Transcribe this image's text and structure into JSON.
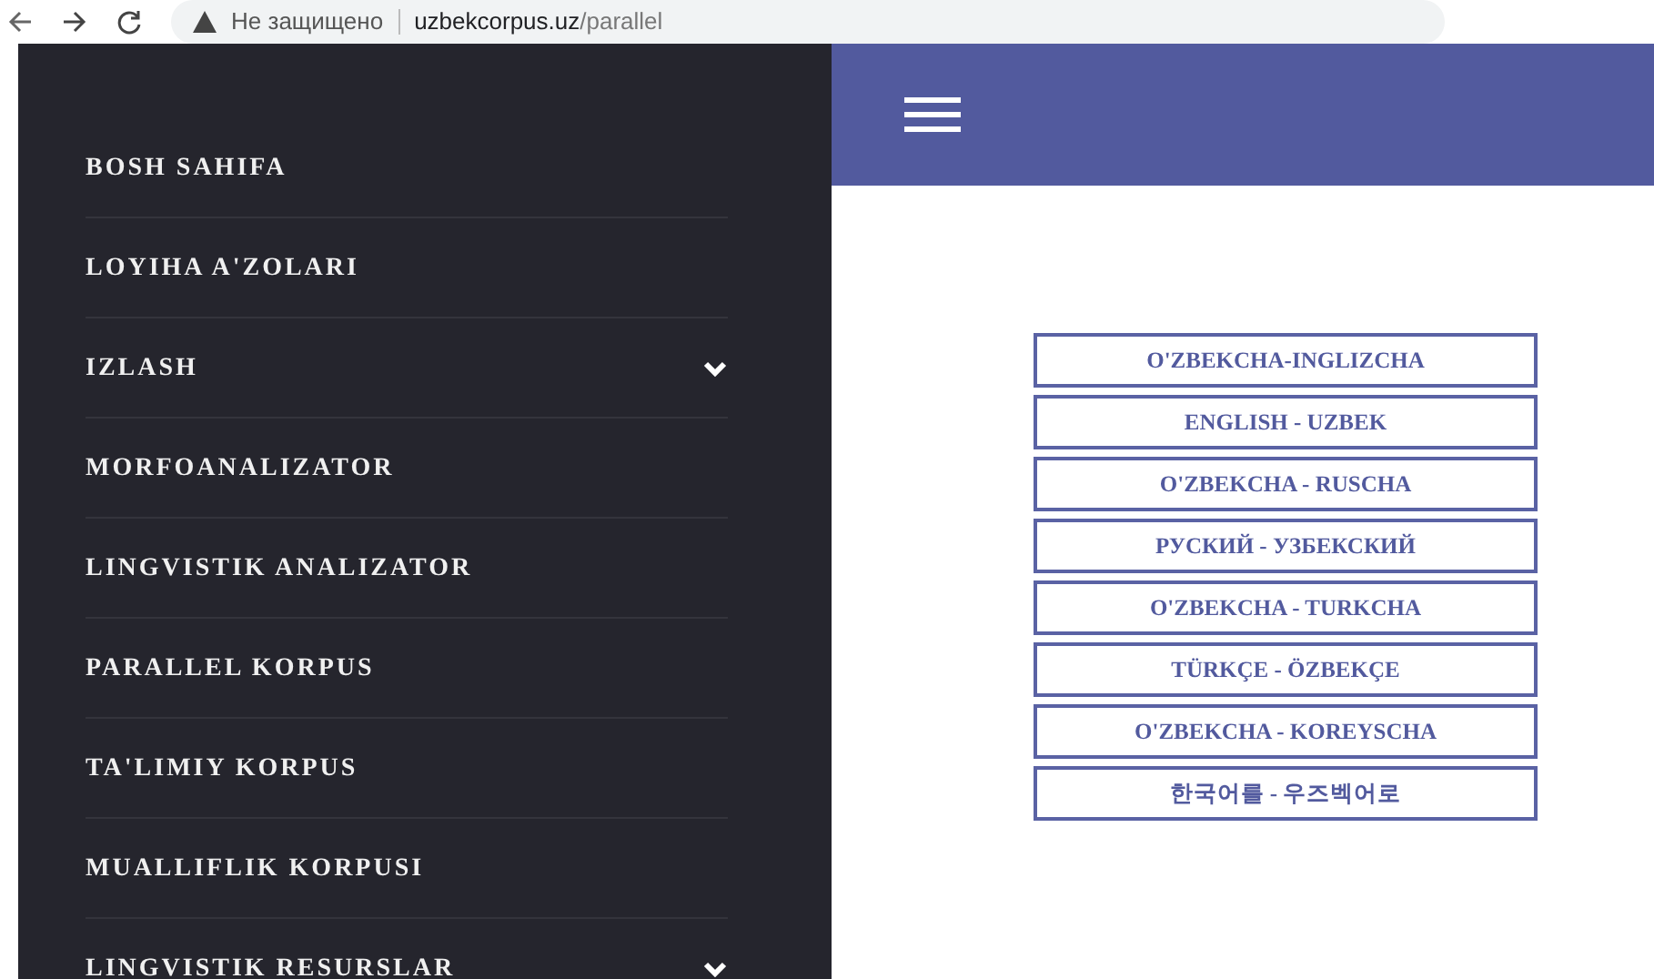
{
  "browser": {
    "security": "Не защищено",
    "url_host": "uzbekcorpus.uz",
    "url_path": "/parallel"
  },
  "sidebar": {
    "items": [
      {
        "label": "BOSH SAHIFA",
        "kind": "link"
      },
      {
        "label": "LOYIHA A'ZOLARI",
        "kind": "link"
      },
      {
        "label": "IZLASH",
        "kind": "dropdown"
      },
      {
        "label": "MORFOANALIZATOR",
        "kind": "link"
      },
      {
        "label": "LINGVISTIK ANALIZATOR",
        "kind": "link"
      },
      {
        "label": "PARALLEL KORPUS",
        "kind": "link"
      },
      {
        "label": "TA'LIMIY KORPUS",
        "kind": "link"
      },
      {
        "label": "MUALLIFLIK KORPUSI",
        "kind": "link"
      },
      {
        "label": "LINGVISTIK RESURSLAR",
        "kind": "dropdown"
      }
    ]
  },
  "language_pairs": [
    "O'ZBEKCHA-INGLIZCHA",
    "ENGLISH - UZBEK",
    "O'ZBEKCHA - RUSCHA",
    "РУСКИЙ - УЗБЕКСКИЙ",
    "O'ZBEKCHA - TURKCHA",
    "TÜRKÇE - ÖZBEKÇE",
    "O'ZBEKCHA - KOREYSCHA",
    "한국어를 - 우즈벡어로"
  ]
}
